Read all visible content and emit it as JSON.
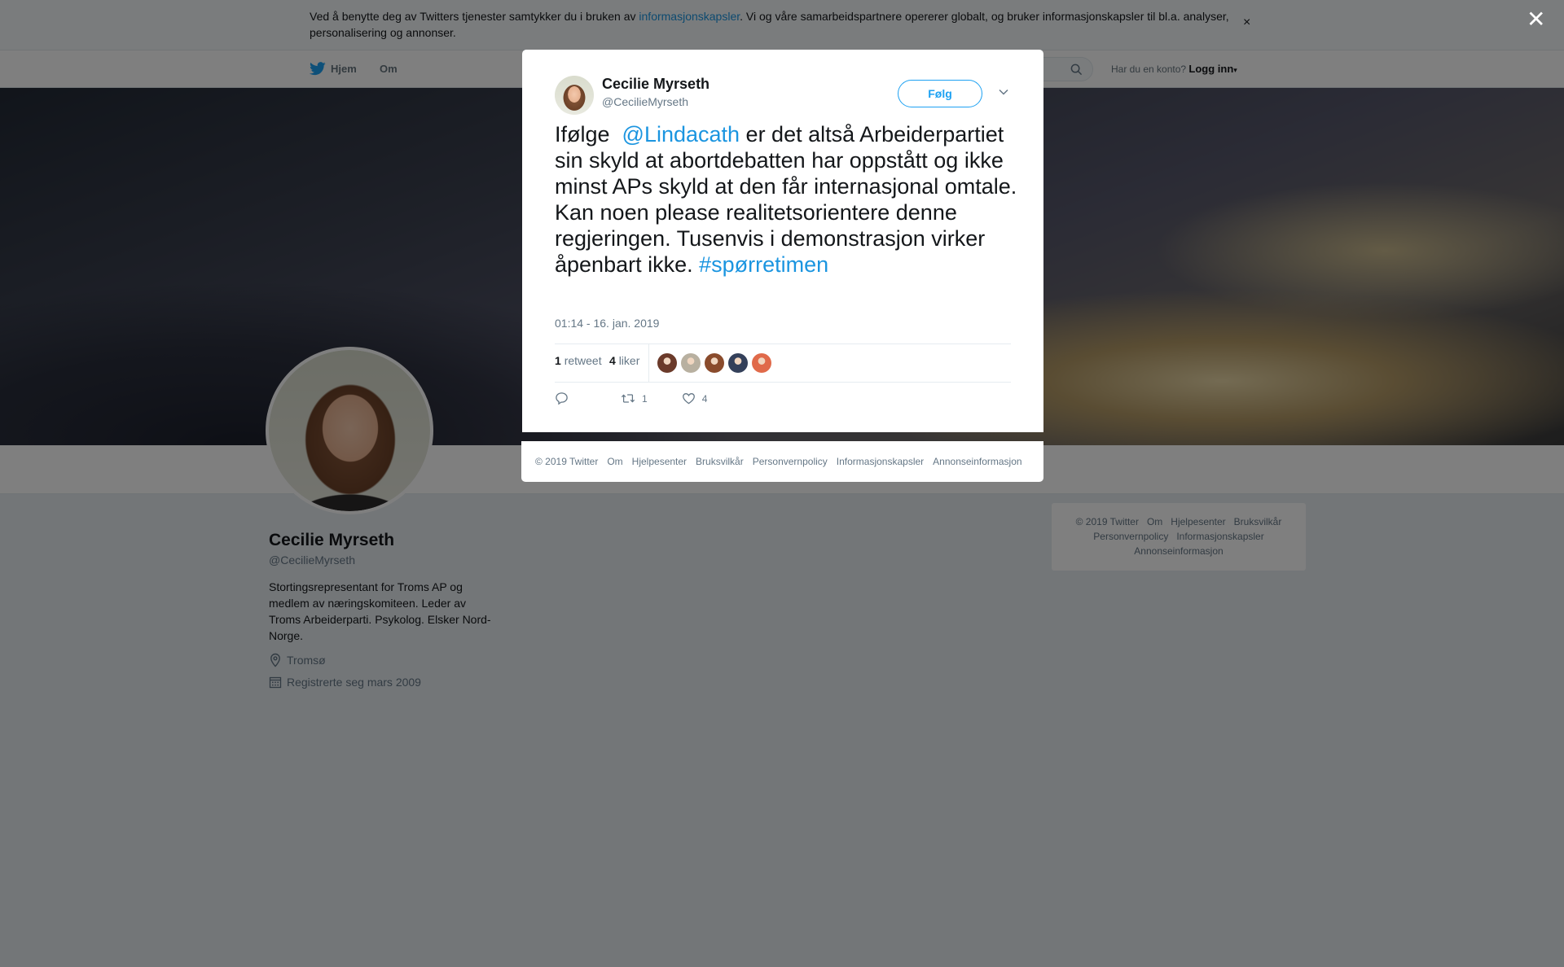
{
  "cookie_bar": {
    "text_before": "Ved å benytte deg av Twitters tjenester samtykker du i bruken av ",
    "link": "informasjonskapsler",
    "text_after": ". Vi og våre samarbeidspartnere opererer globalt, og bruker informasjonskapsler til bl.a. analyser, personalisering og annonser.",
    "close": "×"
  },
  "nav": {
    "home": "Hjem",
    "about": "Om",
    "login_prompt": "Har du en konto?",
    "login": "Logg inn"
  },
  "profile": {
    "name": "Cecilie Myrseth",
    "handle": "@CecilieMyrseth",
    "bio": "Stortingsrepresentant for Troms AP og medlem av næringskomiteen. Leder av Troms Arbeiderparti. Psykolog. Elsker Nord-Norge.",
    "location": "Tromsø",
    "joined": "Registrerte seg mars 2009"
  },
  "side_footer": {
    "items": [
      "© 2019 Twitter",
      "Om",
      "Hjelpesenter",
      "Bruksvilkår",
      "Personvernpolicy",
      "Informasjonskapsler",
      "Annonseinformasjon"
    ]
  },
  "overlay": {
    "close": "✕"
  },
  "tweet": {
    "author_name": "Cecilie Myrseth",
    "author_handle": "@CecilieMyrseth",
    "follow_label": "Følg",
    "text_1": "Ifølge  ",
    "mention": "@Lindacath",
    "text_2": " er det altså Arbeiderpartiet sin skyld at abortdebatten har oppstått og ikke minst APs skyld at den får internasjonal omtale. Kan noen please realitetsorientere denne regjeringen. Tusenvis i demonstrasjon virker åpenbart ikke. ",
    "hashtag": "#spørretimen",
    "date": "01:14 - 16. jan. 2019",
    "retweet_count": "1",
    "retweet_label": "retweet",
    "like_count": "4",
    "like_label": "liker",
    "action_retweets": "1",
    "action_likes": "4",
    "liker_colors": [
      "#6b3a2a",
      "#b8b0a0",
      "#8a4b2c",
      "#34405a",
      "#e06a4a"
    ]
  },
  "modal_footer": {
    "items": [
      "© 2019 Twitter",
      "Om",
      "Hjelpesenter",
      "Bruksvilkår",
      "Personvernpolicy",
      "Informasjonskapsler",
      "Annonseinformasjon"
    ]
  },
  "colors": {
    "link": "#1b95e0",
    "brand": "#1da1f2"
  }
}
